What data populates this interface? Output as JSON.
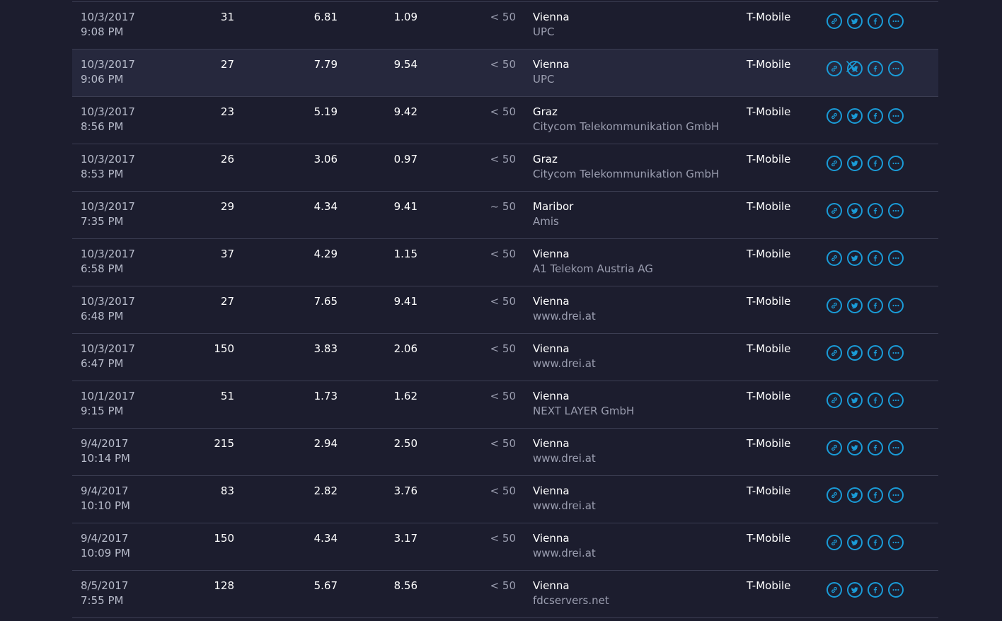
{
  "colors": {
    "background": "#1c1d2e",
    "row_hover": "#26283d",
    "divider": "#3b3d52",
    "accent": "#1a9bd7",
    "muted_text": "#9a9daf"
  },
  "row_icons": [
    "link-icon",
    "twitter-icon",
    "facebook-icon",
    "more-icon"
  ],
  "hover_row_index": 1,
  "close_icon": "close-icon",
  "rows": [
    {
      "date": "10/3/2017",
      "time": "9:08 PM",
      "ping": "31",
      "download": "6.81",
      "upload": "1.09",
      "packet_loss": "< 50",
      "city": "Vienna",
      "isp": "UPC",
      "carrier": "T-Mobile"
    },
    {
      "date": "10/3/2017",
      "time": "9:06 PM",
      "ping": "27",
      "download": "7.79",
      "upload": "9.54",
      "packet_loss": "< 50",
      "city": "Vienna",
      "isp": "UPC",
      "carrier": "T-Mobile"
    },
    {
      "date": "10/3/2017",
      "time": "8:56 PM",
      "ping": "23",
      "download": "5.19",
      "upload": "9.42",
      "packet_loss": "< 50",
      "city": "Graz",
      "isp": "Citycom Telekommunikation GmbH",
      "carrier": "T-Mobile"
    },
    {
      "date": "10/3/2017",
      "time": "8:53 PM",
      "ping": "26",
      "download": "3.06",
      "upload": "0.97",
      "packet_loss": "< 50",
      "city": "Graz",
      "isp": "Citycom Telekommunikation GmbH",
      "carrier": "T-Mobile"
    },
    {
      "date": "10/3/2017",
      "time": "7:35 PM",
      "ping": "29",
      "download": "4.34",
      "upload": "9.41",
      "packet_loss": "~ 50",
      "city": "Maribor",
      "isp": "Amis",
      "carrier": "T-Mobile"
    },
    {
      "date": "10/3/2017",
      "time": "6:58 PM",
      "ping": "37",
      "download": "4.29",
      "upload": "1.15",
      "packet_loss": "< 50",
      "city": "Vienna",
      "isp": "A1 Telekom Austria AG",
      "carrier": "T-Mobile"
    },
    {
      "date": "10/3/2017",
      "time": "6:48 PM",
      "ping": "27",
      "download": "7.65",
      "upload": "9.41",
      "packet_loss": "< 50",
      "city": "Vienna",
      "isp": "www.drei.at",
      "carrier": "T-Mobile"
    },
    {
      "date": "10/3/2017",
      "time": "6:47 PM",
      "ping": "150",
      "download": "3.83",
      "upload": "2.06",
      "packet_loss": "< 50",
      "city": "Vienna",
      "isp": "www.drei.at",
      "carrier": "T-Mobile"
    },
    {
      "date": "10/1/2017",
      "time": "9:15 PM",
      "ping": "51",
      "download": "1.73",
      "upload": "1.62",
      "packet_loss": "< 50",
      "city": "Vienna",
      "isp": "NEXT LAYER GmbH",
      "carrier": "T-Mobile"
    },
    {
      "date": "9/4/2017",
      "time": "10:14 PM",
      "ping": "215",
      "download": "2.94",
      "upload": "2.50",
      "packet_loss": "< 50",
      "city": "Vienna",
      "isp": "www.drei.at",
      "carrier": "T-Mobile"
    },
    {
      "date": "9/4/2017",
      "time": "10:10 PM",
      "ping": "83",
      "download": "2.82",
      "upload": "3.76",
      "packet_loss": "< 50",
      "city": "Vienna",
      "isp": "www.drei.at",
      "carrier": "T-Mobile"
    },
    {
      "date": "9/4/2017",
      "time": "10:09 PM",
      "ping": "150",
      "download": "4.34",
      "upload": "3.17",
      "packet_loss": "< 50",
      "city": "Vienna",
      "isp": "www.drei.at",
      "carrier": "T-Mobile"
    },
    {
      "date": "8/5/2017",
      "time": "7:55 PM",
      "ping": "128",
      "download": "5.67",
      "upload": "8.56",
      "packet_loss": "< 50",
      "city": "Vienna",
      "isp": "fdcservers.net",
      "carrier": "T-Mobile"
    }
  ]
}
